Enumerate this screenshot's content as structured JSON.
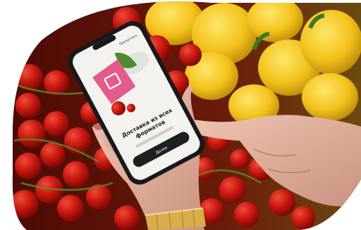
{
  "photo": {
    "colors": {
      "tomato": "#c8170f",
      "tomato_dark": "#7e0906",
      "pepper": "#f2c21a",
      "leaf": "#4f8a2e",
      "skin": "#e4b5a0",
      "nail": "#d1665f",
      "watch_gold": "#d8ad4a",
      "phone_frame": "#18191c"
    }
  },
  "phone_screen": {
    "top_label": "Пропустить",
    "headline_line1": "Доставка из всех",
    "headline_line2": "форматов",
    "button_label": "Далее",
    "colors": {
      "screen_bg": "#f4f2ef",
      "product_pink": "#e45a8a",
      "button_bg": "#1f1f1f",
      "button_text": "#ffffff"
    }
  }
}
